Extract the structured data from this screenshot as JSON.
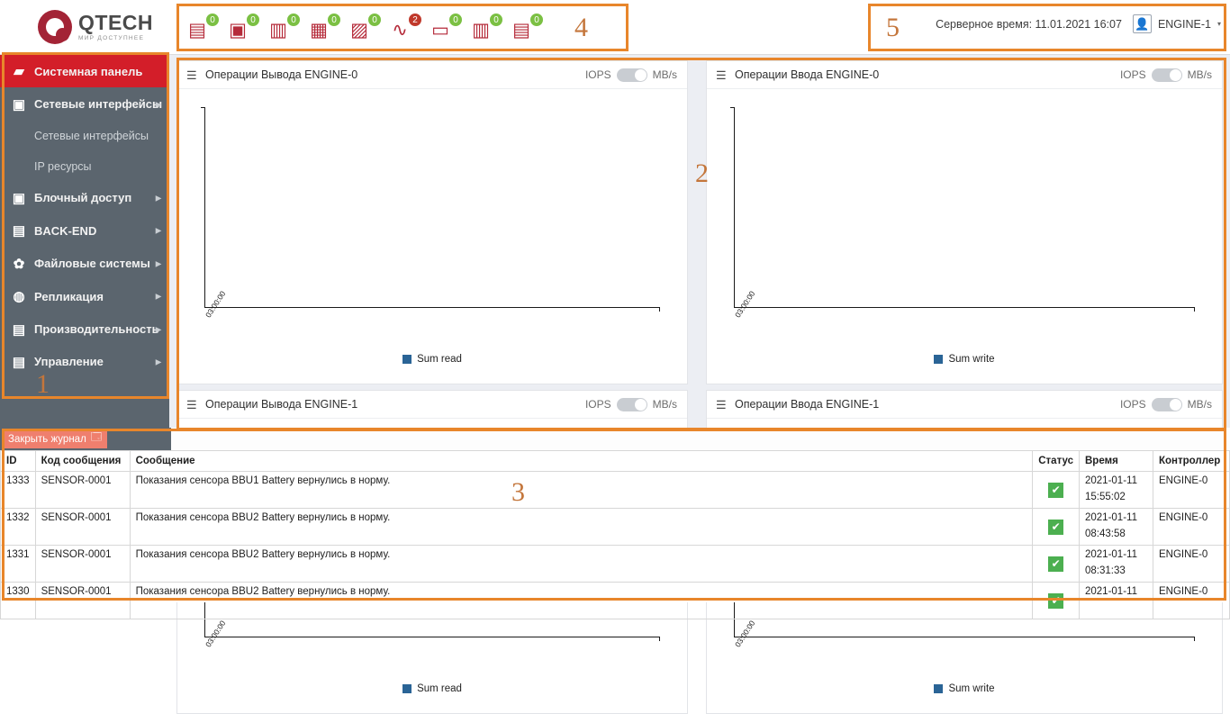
{
  "brand": {
    "name": "QTECH",
    "tagline": "МИР ДОСТУПНЕЕ"
  },
  "header": {
    "server_time_label": "Серверное время: 11.01.2021 16:07",
    "user": "ENGINE-1",
    "caret": "▾",
    "user_icon": "user-icon"
  },
  "toolbar": {
    "items": [
      {
        "icon": "database-stack-icon",
        "glyph": "▤",
        "badge": "0",
        "alert": false
      },
      {
        "icon": "disk-drive-icon",
        "glyph": "▣",
        "badge": "0",
        "alert": false
      },
      {
        "icon": "server-rack-icon",
        "glyph": "▥",
        "badge": "0",
        "alert": false
      },
      {
        "icon": "server-settings-icon",
        "glyph": "▦",
        "badge": "0",
        "alert": false
      },
      {
        "icon": "network-port-icon",
        "glyph": "▨",
        "badge": "0",
        "alert": false
      },
      {
        "icon": "signal-alert-icon",
        "glyph": "∿",
        "badge": "2",
        "alert": true
      },
      {
        "icon": "folder-add-icon",
        "glyph": "▭",
        "badge": "0",
        "alert": false
      },
      {
        "icon": "memory-module-icon",
        "glyph": "▥",
        "badge": "0",
        "alert": false
      },
      {
        "icon": "replication-link-icon",
        "glyph": "▤",
        "badge": "0",
        "alert": false
      }
    ]
  },
  "sidebar": {
    "items": [
      {
        "label": "Системная панель",
        "icon": "dashboard-icon",
        "glyph": "▰",
        "active": true,
        "arrow": false
      },
      {
        "label": "Сетевые интерфейсы",
        "icon": "ethernet-icon",
        "glyph": "▣",
        "active": false,
        "arrow": true
      },
      {
        "label": "Блочный доступ",
        "icon": "block-device-icon",
        "glyph": "▣",
        "active": false,
        "arrow": true
      },
      {
        "label": "BACK-END",
        "icon": "database-icon",
        "glyph": "▤",
        "active": false,
        "arrow": true
      },
      {
        "label": "Файловые системы",
        "icon": "gears-icon",
        "glyph": "✿",
        "active": false,
        "arrow": true
      },
      {
        "label": "Репликация",
        "icon": "refresh-circle-icon",
        "glyph": "◍",
        "active": false,
        "arrow": true
      },
      {
        "label": "Производительность",
        "icon": "bar-chart-icon",
        "glyph": "▤",
        "active": false,
        "arrow": true
      },
      {
        "label": "Управление",
        "icon": "toggles-icon",
        "glyph": "▤",
        "active": false,
        "arrow": true
      }
    ],
    "subitems": [
      {
        "label": "Сетевые интерфейсы"
      },
      {
        "label": "IP ресурсы"
      }
    ]
  },
  "panels": [
    {
      "title": "Операции Вывода ENGINE-0",
      "left_unit": "IOPS",
      "right_unit": "MB/s",
      "legend": "Sum read",
      "xtick": "03:00:00"
    },
    {
      "title": "Операции Ввода ENGINE-0",
      "left_unit": "IOPS",
      "right_unit": "MB/s",
      "legend": "Sum write",
      "xtick": "03:00:00"
    },
    {
      "title": "Операции Вывода ENGINE-1",
      "left_unit": "IOPS",
      "right_unit": "MB/s",
      "legend": "Sum read",
      "xtick": "03:00:00"
    },
    {
      "title": "Операции Ввода ENGINE-1",
      "left_unit": "IOPS",
      "right_unit": "MB/s",
      "legend": "Sum write",
      "xtick": "03:00:00"
    }
  ],
  "chart_data": {
    "type": "line",
    "title": "Операции Вывода ENGINE-0",
    "xlabel": "",
    "ylabel": "",
    "x": [
      "03:00:00"
    ],
    "series": [
      {
        "name": "Sum read",
        "values": [],
        "color": "#2a6496"
      }
    ],
    "legend_position": "bottom",
    "grid": false,
    "note": "Empty plot: axes drawn, no data points rendered"
  },
  "log": {
    "close_button": "Закрыть журнал",
    "close_icon": "close-journal-icon",
    "columns": [
      "ID",
      "Код сообщения",
      "Сообщение",
      "Статус",
      "Время",
      "Контроллер"
    ],
    "rows": [
      {
        "id": "1333",
        "code": "SENSOR-0001",
        "message": "Показания сенсора BBU1 Battery вернулись в норму.",
        "status": "✔",
        "date": "2021-01-11",
        "time": "15:55:02",
        "controller": "ENGINE-0"
      },
      {
        "id": "1332",
        "code": "SENSOR-0001",
        "message": "Показания сенсора BBU2 Battery вернулись в норму.",
        "status": "✔",
        "date": "2021-01-11",
        "time": "08:43:58",
        "controller": "ENGINE-0"
      },
      {
        "id": "1331",
        "code": "SENSOR-0001",
        "message": "Показания сенсора BBU2 Battery вернулись в норму.",
        "status": "✔",
        "date": "2021-01-11",
        "time": "08:31:33",
        "controller": "ENGINE-0"
      },
      {
        "id": "1330",
        "code": "SENSOR-0001",
        "message": "Показания сенсора BBU2 Battery вернулись в норму.",
        "status": "✔",
        "date": "2021-01-11",
        "time": "",
        "controller": "ENGINE-0"
      }
    ]
  },
  "annotations": [
    {
      "number": "1"
    },
    {
      "number": "2"
    },
    {
      "number": "3"
    },
    {
      "number": "4"
    },
    {
      "number": "5"
    }
  ],
  "colors": {
    "accent": "#e8862b",
    "brand_red": "#a32436",
    "active_red": "#d31e29",
    "sidebar": "#5b656e",
    "ok_green": "#4caf50",
    "series_blue": "#2a6496"
  }
}
